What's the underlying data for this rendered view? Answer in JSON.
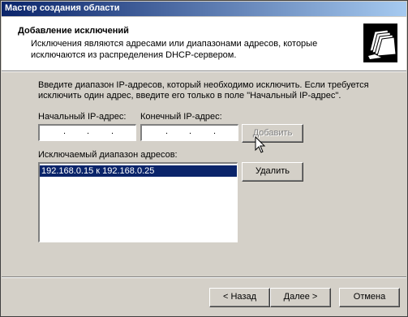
{
  "window": {
    "title": "Мастер создания области"
  },
  "header": {
    "title": "Добавление исключений",
    "subtitle": "Исключения являются адресами или диапазонами адресов, которые исключаются из распределения DHCP-сервером."
  },
  "intro_text": "Введите диапазон IP-адресов, который необходимо исключить. Если требуется исключить один адрес, введите его только в поле \"Начальный IP-адрес\".",
  "start_ip": {
    "label": "Начальный IP-адрес:",
    "value": ""
  },
  "end_ip": {
    "label": "Конечный IP-адрес:",
    "value": ""
  },
  "add_button": "Добавить",
  "excluded": {
    "label": "Исключаемый диапазон адресов:",
    "items": [
      "192.168.0.15 к 192.168.0.25"
    ]
  },
  "remove_button": "Удалить",
  "footer": {
    "back": "< Назад",
    "next": "Далее >",
    "cancel": "Отмена"
  },
  "icons": {
    "header": "folder-stack-icon",
    "cursor": "mouse-pointer-icon"
  }
}
